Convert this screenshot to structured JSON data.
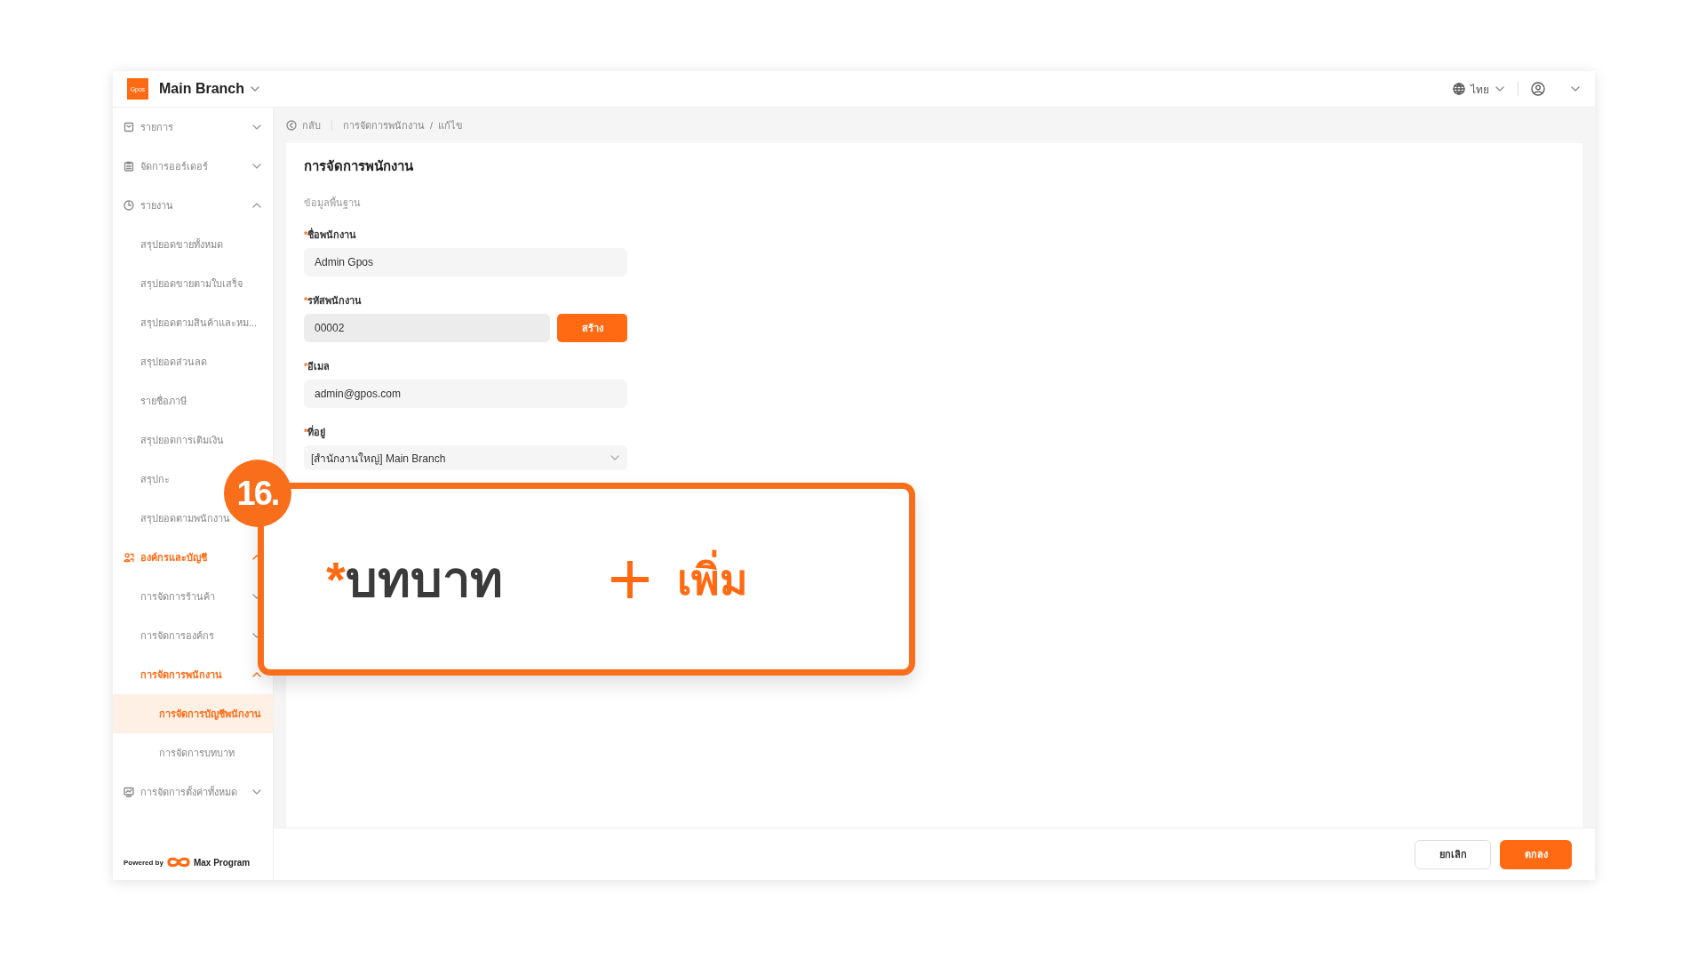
{
  "header": {
    "logo": "Gpos",
    "branch": "Main Branch",
    "language": "ไทย"
  },
  "sidebar": {
    "items": [
      {
        "label": "รายการ",
        "expanded": false,
        "selected": false
      },
      {
        "label": "จัดการออร์เดอร์",
        "expanded": false,
        "selected": false
      },
      {
        "label": "รายงาน",
        "expanded": true,
        "selected": false,
        "children": [
          {
            "label": "สรุปยอดขายทั้งหมด",
            "selected": false
          },
          {
            "label": "สรุปยอดขายตามใบเสร็จ",
            "selected": false
          },
          {
            "label": "สรุปยอดตามสินค้าและหม...",
            "selected": false
          },
          {
            "label": "สรุปยอดส่วนลด",
            "selected": false
          },
          {
            "label": "รายชื่อภาษี",
            "selected": false
          },
          {
            "label": "สรุปยอดการเติมเงิน",
            "selected": false
          },
          {
            "label": "สรุปกะ",
            "selected": false
          },
          {
            "label": "สรุปยอดตามพนักงาน",
            "selected": false
          }
        ]
      },
      {
        "label": "องค์กรและบัญชี",
        "expanded": true,
        "selected": true,
        "children": [
          {
            "label": "การจัดการร้านค้า",
            "expanded": false,
            "selected": false
          },
          {
            "label": "การจัดการองค์กร",
            "expanded": false,
            "selected": false
          },
          {
            "label": "การจัดการพนักงาน",
            "expanded": true,
            "selected": true,
            "children": [
              {
                "label": "การจัดการบัญชีพนักงาน",
                "selected": true
              },
              {
                "label": "การจัดการบทบาท",
                "selected": false
              }
            ]
          }
        ]
      },
      {
        "label": "การจัดการตั้งค่าทั้งหมด",
        "expanded": false,
        "selected": false
      }
    ],
    "powered_by": "Powered by",
    "brand": "Max Program"
  },
  "breadcrumb": {
    "back": "กลับ",
    "path": [
      "การจัดการพนักงาน",
      "แก้ไข"
    ],
    "separator": "/"
  },
  "form": {
    "title": "การจัดการพนักงาน",
    "section": "ข้อมูลพื้นฐาน",
    "fields": [
      {
        "kind": "input",
        "mark": "*",
        "label": "ชื่อพนักงาน",
        "value": "Admin Gpos"
      },
      {
        "kind": "input_button",
        "mark": "*",
        "label": "รหัสพนักงาน",
        "value": "00002",
        "button": "สร้าง"
      },
      {
        "kind": "input",
        "mark": "*",
        "label": "อีเมล",
        "value": "admin@gpos.com"
      },
      {
        "kind": "select",
        "mark": "*",
        "label": "ที่อยู่",
        "value": "[สำนักงานใหญ่] Main Branch"
      }
    ]
  },
  "callout": {
    "number": "16.",
    "mark": "*",
    "label": "บทบาท",
    "add": "เพิ่ม"
  },
  "footer": {
    "buttons": [
      {
        "kind": "secondary",
        "label": "ยกเลิก"
      },
      {
        "kind": "primary",
        "label": "ตกลง"
      }
    ]
  }
}
